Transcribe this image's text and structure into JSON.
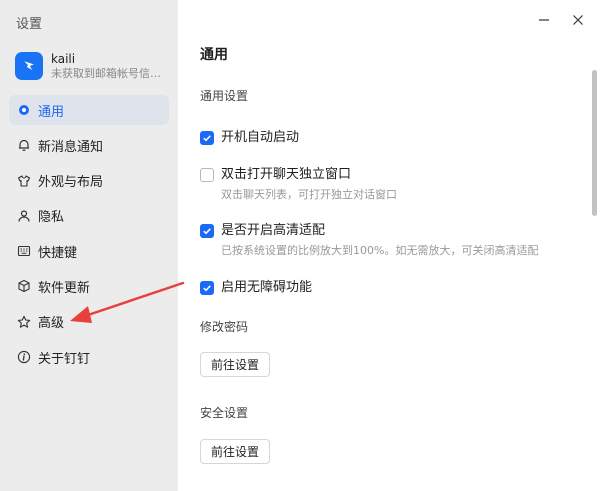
{
  "sidebar": {
    "title": "设置",
    "account": {
      "name": "kaili",
      "subtitle": "未获取到邮箱帐号信息..."
    },
    "items": [
      {
        "label": "通用",
        "icon": "general-dot-icon",
        "active": true
      },
      {
        "label": "新消息通知",
        "icon": "bell-icon"
      },
      {
        "label": "外观与布局",
        "icon": "tshirt-icon"
      },
      {
        "label": "隐私",
        "icon": "person-icon"
      },
      {
        "label": "快捷键",
        "icon": "keyboard-icon"
      },
      {
        "label": "软件更新",
        "icon": "cube-icon"
      },
      {
        "label": "高级",
        "icon": "star-icon"
      },
      {
        "label": "关于钉钉",
        "icon": "info-icon"
      }
    ]
  },
  "main": {
    "title": "通用",
    "general_section": "通用设置",
    "options": [
      {
        "label": "开机自动启动",
        "checked": true,
        "desc": ""
      },
      {
        "label": "双击打开聊天独立窗口",
        "checked": false,
        "desc": "双击聊天列表，可打开独立对话窗口"
      },
      {
        "label": "是否开启高清适配",
        "checked": true,
        "desc": "已按系统设置的比例放大到100%。如无需放大，可关闭高清适配"
      },
      {
        "label": "启用无障碍功能",
        "checked": true,
        "desc": ""
      }
    ],
    "password_section": "修改密码",
    "password_button": "前往设置",
    "security_section": "安全设置",
    "security_button": "前往设置"
  },
  "colors": {
    "accent": "#1a6af5",
    "annotation_arrow": "#e8413c"
  }
}
